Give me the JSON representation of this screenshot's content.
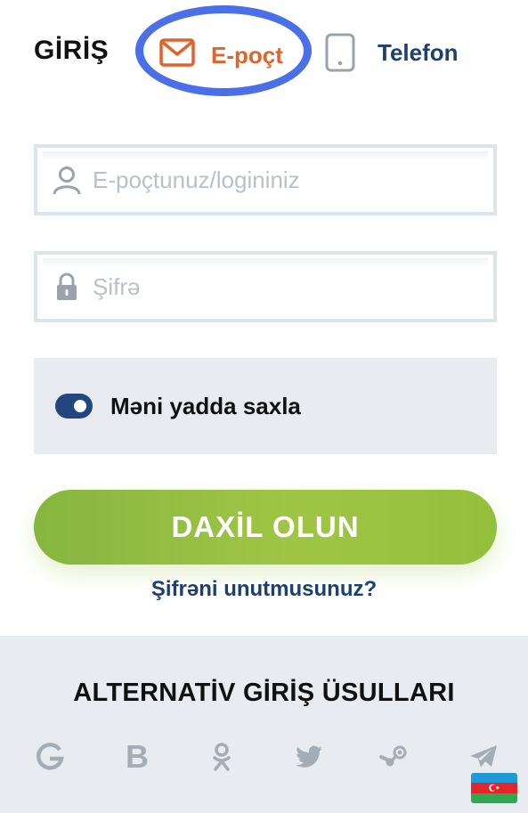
{
  "header": {
    "title": "GİRİŞ",
    "tabs": [
      {
        "label": "E-poçt",
        "icon": "mail-icon",
        "active": true,
        "color": "#e0642a"
      },
      {
        "label": "Telefon",
        "icon": "phone-icon",
        "active": false,
        "color": "#1f3f6e"
      }
    ],
    "highlight_color": "#4a6fe8"
  },
  "form": {
    "email_placeholder": "E-poçtunuz/logininiz",
    "email_value": "",
    "password_placeholder": "Şifrə",
    "password_value": "",
    "remember_label": "Məni yadda saxla",
    "remember_checked": true,
    "submit_label": "DAXİL OLUN",
    "forgot_label": "Şifrəni unutmusunuz?"
  },
  "alternative": {
    "title": "ALTERNATİV GİRİŞ ÜSULLARI",
    "providers": [
      {
        "name": "google",
        "icon": "google-icon"
      },
      {
        "name": "b",
        "icon": "b-icon",
        "letter": "B"
      },
      {
        "name": "odnoklassniki",
        "icon": "odnoklassniki-icon"
      },
      {
        "name": "twitter",
        "icon": "twitter-icon"
      },
      {
        "name": "steam",
        "icon": "steam-icon"
      },
      {
        "name": "telegram",
        "icon": "telegram-icon"
      }
    ]
  },
  "language": {
    "icon": "azerbaijan-flag-icon"
  },
  "colors": {
    "accent_green": "#93c03c",
    "navy": "#1f3f6e",
    "panel_gray": "#e8ecf1",
    "icon_gray": "#a4acb5"
  }
}
